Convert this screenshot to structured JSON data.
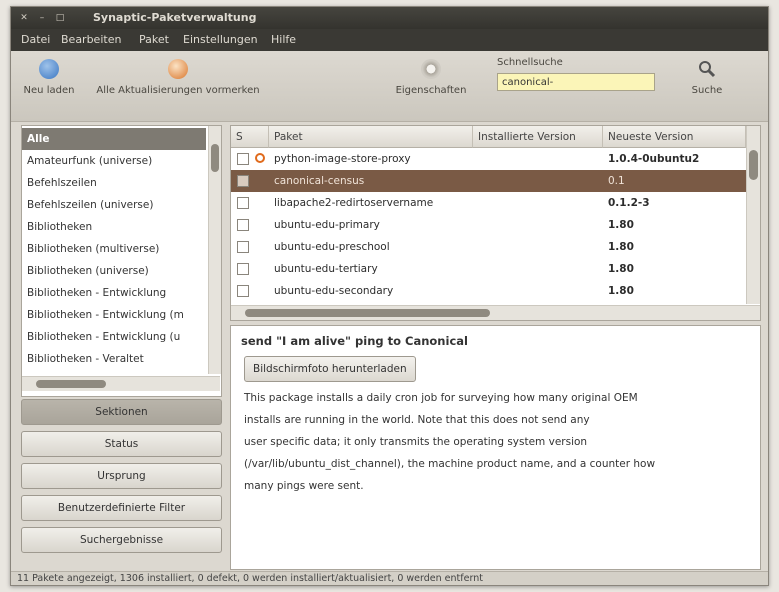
{
  "window": {
    "title": "Synaptic-Paketverwaltung"
  },
  "menu": [
    "Datei",
    "Bearbeiten",
    "Paket",
    "Einstellungen",
    "Hilfe"
  ],
  "toolbar": {
    "reload": "Neu laden",
    "mark_all": "Alle Aktualisierungen vormerken",
    "properties": "Eigenschaften",
    "quick_search_label": "Schnellsuche",
    "quick_search_value": "canonical-",
    "search": "Suche"
  },
  "categories": [
    "Alle",
    "Amateurfunk (universe)",
    "Befehlszeilen",
    "Befehlszeilen (universe)",
    "Bibliotheken",
    "Bibliotheken (multiverse)",
    "Bibliotheken (universe)",
    "Bibliotheken - Entwicklung",
    "Bibliotheken - Entwicklung (m",
    "Bibliotheken - Entwicklung (u",
    "Bibliotheken - Veraltet"
  ],
  "filter_buttons": [
    "Sektionen",
    "Status",
    "Ursprung",
    "Benutzerdefinierte Filter",
    "Suchergebnisse"
  ],
  "table": {
    "columns": [
      "S",
      "Paket",
      "Installierte Version",
      "Neueste Version"
    ],
    "rows": [
      {
        "name": "python-image-store-proxy",
        "installed": "",
        "latest": "1.0.4-0ubuntu2"
      },
      {
        "name": "canonical-census",
        "installed": "",
        "latest": "0.1"
      },
      {
        "name": "libapache2-redirtoservername",
        "installed": "",
        "latest": "0.1.2-3"
      },
      {
        "name": "ubuntu-edu-primary",
        "installed": "",
        "latest": "1.80"
      },
      {
        "name": "ubuntu-edu-preschool",
        "installed": "",
        "latest": "1.80"
      },
      {
        "name": "ubuntu-edu-tertiary",
        "installed": "",
        "latest": "1.80"
      },
      {
        "name": "ubuntu-edu-secondary",
        "installed": "",
        "latest": "1.80"
      }
    ]
  },
  "description": {
    "title": "send \"I am alive\" ping to Canonical",
    "screenshot_button": "Bildschirmfoto herunterladen",
    "lines": [
      "This package installs a daily cron job for surveying how many original OEM",
      "installs are running in the world. Note that this does not send any",
      "user specific data; it only transmits the operating system version",
      "(/var/lib/ubuntu_dist_channel), the machine product name, and a counter how",
      "many pings were sent."
    ]
  },
  "status": "11 Pakete angezeigt, 1306 installiert, 0 defekt, 0 werden installiert/aktualisiert, 0 werden entfernt"
}
